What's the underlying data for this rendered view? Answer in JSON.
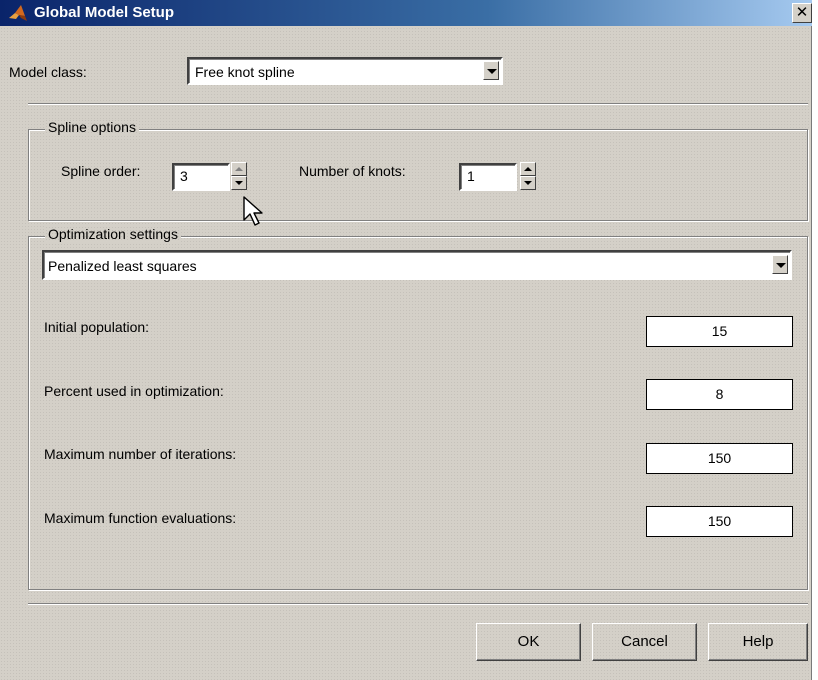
{
  "window": {
    "title": "Global Model Setup",
    "close_glyph": "✕"
  },
  "model_class": {
    "label": "Model class:",
    "value": "Free knot spline"
  },
  "spline_options": {
    "group_title": "Spline options",
    "order_label": "Spline order:",
    "order_value": "3",
    "knots_label": "Number of knots:",
    "knots_value": "1"
  },
  "optimization": {
    "group_title": "Optimization settings",
    "method": "Penalized least squares",
    "fields": [
      {
        "label": "Initial population:",
        "value": "15"
      },
      {
        "label": "Percent used in optimization:",
        "value": "8"
      },
      {
        "label": "Maximum number of iterations:",
        "value": "150"
      },
      {
        "label": "Maximum function evaluations:",
        "value": "150"
      }
    ]
  },
  "buttons": {
    "ok": "OK",
    "cancel": "Cancel",
    "help": "Help"
  },
  "icons": {
    "title": "matlab-logo-icon",
    "pointer": "mouse-pointer-icon"
  },
  "colors": {
    "titlebar_start": "#0a246a",
    "titlebar_end": "#a6caf0",
    "face": "#d4d0c8"
  }
}
